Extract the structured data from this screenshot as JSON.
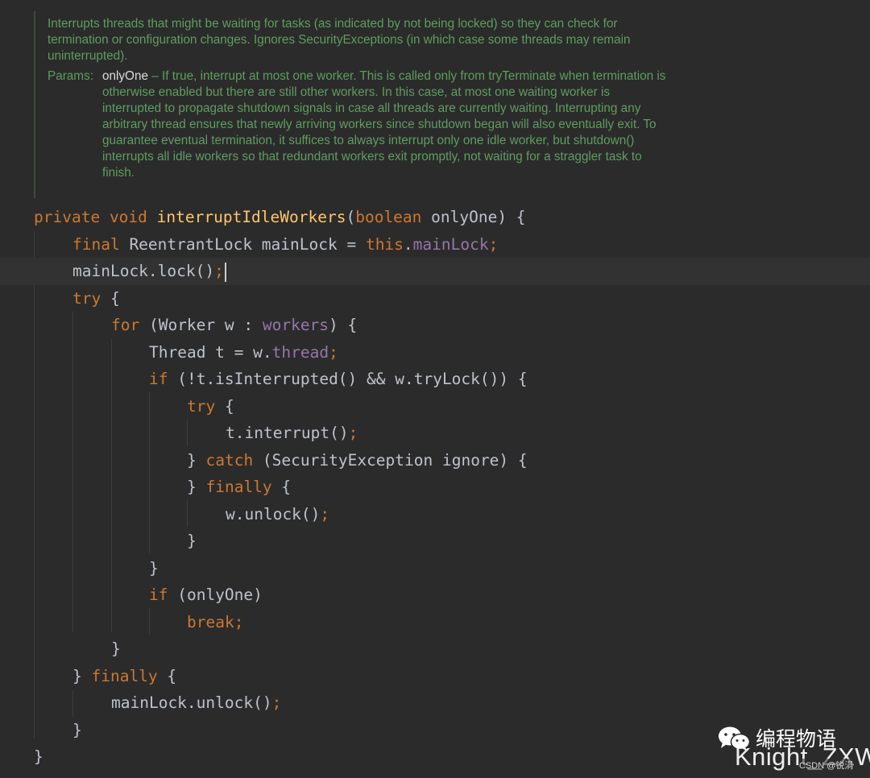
{
  "doc": {
    "description": "Interrupts threads that might be waiting for tasks (as indicated by not being locked) so they can check for termination or configuration changes. Ignores SecurityExceptions (in which case some threads may remain uninterrupted).",
    "params_label": "Params:",
    "param_name": "onlyOne",
    "param_desc": " – If true, interrupt at most one worker. This is called only from tryTerminate when termination is otherwise enabled but there are still other workers. In this case, at most one waiting worker is interrupted to propagate shutdown signals in case all threads are currently waiting. Interrupting any arbitrary thread ensures that newly arriving workers since shutdown began will also eventually exit. To guarantee eventual termination, it suffices to always interrupt only one idle worker, but shutdown() interrupts all idle workers so that redundant workers exit promptly, not waiting for a straggler task to finish."
  },
  "code": {
    "l1": {
      "private": "private",
      "void": "void",
      "name": "interruptIdleWorkers",
      "open": "(",
      "boolean": "boolean",
      "rest": " onlyOne) {"
    },
    "l2": {
      "final": "final",
      "decl": " ReentrantLock mainLock = ",
      "this": "this",
      "dot": ".",
      "field": "mainLock",
      "semi": ";"
    },
    "l3": {
      "call": "mainLock.lock()",
      "semi": ";"
    },
    "l4": {
      "try": "try",
      "brace": " {"
    },
    "l5": {
      "for": "for",
      "open": " (Worker w : ",
      "field": "workers",
      "close": ") {"
    },
    "l6": {
      "decl": "Thread t = w.",
      "field": "thread",
      "semi": ";"
    },
    "l7": {
      "if": "if",
      "cond": " (!t.isInterrupted() && w.tryLock()) {"
    },
    "l8": {
      "try": "try",
      "brace": " {"
    },
    "l9": {
      "call": "t.interrupt()",
      "semi": ";"
    },
    "l10": {
      "close": "} ",
      "catch": "catch",
      "rest": " (SecurityException ignore) {"
    },
    "l11": {
      "close": "} ",
      "finally": "finally",
      "brace": " {"
    },
    "l12": {
      "call": "w.unlock()",
      "semi": ";"
    },
    "l13": {
      "close": "}"
    },
    "l14": {
      "close": "}"
    },
    "l15": {
      "if": "if",
      "cond": " (onlyOne)"
    },
    "l16": {
      "break": "break",
      "semi": ";"
    },
    "l17": {
      "close": "}"
    },
    "l18": {
      "close": "} ",
      "finally": "finally",
      "brace": " {"
    },
    "l19": {
      "call": "mainLock.unlock()",
      "semi": ";"
    },
    "l20": {
      "close": "}"
    },
    "l21": {
      "close": "}"
    }
  },
  "watermark": {
    "brand": "编程物语",
    "author": "Knight_ZXW",
    "source": "CSDN @锐涓"
  },
  "colors": {
    "background": "#2b2b2b",
    "keyword": "#cc7832",
    "method": "#ffc66d",
    "field": "#9876aa",
    "doc_comment": "#5f9d5f"
  }
}
